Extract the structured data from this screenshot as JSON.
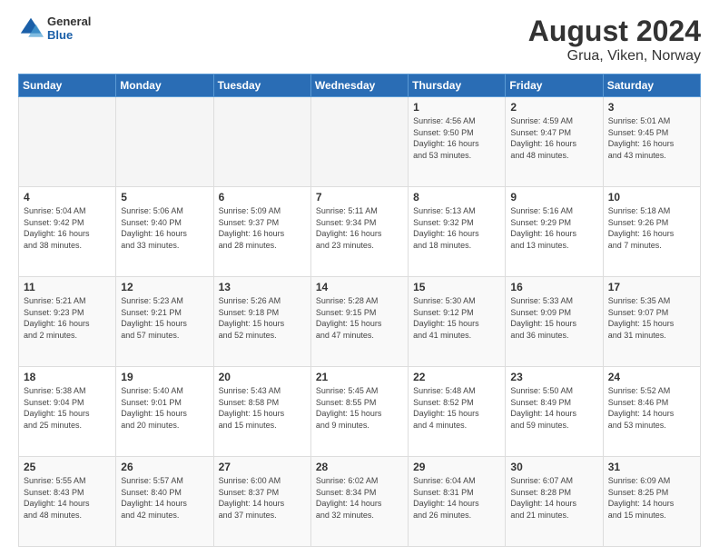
{
  "header": {
    "logo": {
      "general": "General",
      "blue": "Blue"
    },
    "title": "August 2024",
    "subtitle": "Grua, Viken, Norway"
  },
  "weekdays": [
    "Sunday",
    "Monday",
    "Tuesday",
    "Wednesday",
    "Thursday",
    "Friday",
    "Saturday"
  ],
  "weeks": [
    [
      {
        "day": "",
        "info": ""
      },
      {
        "day": "",
        "info": ""
      },
      {
        "day": "",
        "info": ""
      },
      {
        "day": "",
        "info": ""
      },
      {
        "day": "1",
        "info": "Sunrise: 4:56 AM\nSunset: 9:50 PM\nDaylight: 16 hours\nand 53 minutes."
      },
      {
        "day": "2",
        "info": "Sunrise: 4:59 AM\nSunset: 9:47 PM\nDaylight: 16 hours\nand 48 minutes."
      },
      {
        "day": "3",
        "info": "Sunrise: 5:01 AM\nSunset: 9:45 PM\nDaylight: 16 hours\nand 43 minutes."
      }
    ],
    [
      {
        "day": "4",
        "info": "Sunrise: 5:04 AM\nSunset: 9:42 PM\nDaylight: 16 hours\nand 38 minutes."
      },
      {
        "day": "5",
        "info": "Sunrise: 5:06 AM\nSunset: 9:40 PM\nDaylight: 16 hours\nand 33 minutes."
      },
      {
        "day": "6",
        "info": "Sunrise: 5:09 AM\nSunset: 9:37 PM\nDaylight: 16 hours\nand 28 minutes."
      },
      {
        "day": "7",
        "info": "Sunrise: 5:11 AM\nSunset: 9:34 PM\nDaylight: 16 hours\nand 23 minutes."
      },
      {
        "day": "8",
        "info": "Sunrise: 5:13 AM\nSunset: 9:32 PM\nDaylight: 16 hours\nand 18 minutes."
      },
      {
        "day": "9",
        "info": "Sunrise: 5:16 AM\nSunset: 9:29 PM\nDaylight: 16 hours\nand 13 minutes."
      },
      {
        "day": "10",
        "info": "Sunrise: 5:18 AM\nSunset: 9:26 PM\nDaylight: 16 hours\nand 7 minutes."
      }
    ],
    [
      {
        "day": "11",
        "info": "Sunrise: 5:21 AM\nSunset: 9:23 PM\nDaylight: 16 hours\nand 2 minutes."
      },
      {
        "day": "12",
        "info": "Sunrise: 5:23 AM\nSunset: 9:21 PM\nDaylight: 15 hours\nand 57 minutes."
      },
      {
        "day": "13",
        "info": "Sunrise: 5:26 AM\nSunset: 9:18 PM\nDaylight: 15 hours\nand 52 minutes."
      },
      {
        "day": "14",
        "info": "Sunrise: 5:28 AM\nSunset: 9:15 PM\nDaylight: 15 hours\nand 47 minutes."
      },
      {
        "day": "15",
        "info": "Sunrise: 5:30 AM\nSunset: 9:12 PM\nDaylight: 15 hours\nand 41 minutes."
      },
      {
        "day": "16",
        "info": "Sunrise: 5:33 AM\nSunset: 9:09 PM\nDaylight: 15 hours\nand 36 minutes."
      },
      {
        "day": "17",
        "info": "Sunrise: 5:35 AM\nSunset: 9:07 PM\nDaylight: 15 hours\nand 31 minutes."
      }
    ],
    [
      {
        "day": "18",
        "info": "Sunrise: 5:38 AM\nSunset: 9:04 PM\nDaylight: 15 hours\nand 25 minutes."
      },
      {
        "day": "19",
        "info": "Sunrise: 5:40 AM\nSunset: 9:01 PM\nDaylight: 15 hours\nand 20 minutes."
      },
      {
        "day": "20",
        "info": "Sunrise: 5:43 AM\nSunset: 8:58 PM\nDaylight: 15 hours\nand 15 minutes."
      },
      {
        "day": "21",
        "info": "Sunrise: 5:45 AM\nSunset: 8:55 PM\nDaylight: 15 hours\nand 9 minutes."
      },
      {
        "day": "22",
        "info": "Sunrise: 5:48 AM\nSunset: 8:52 PM\nDaylight: 15 hours\nand 4 minutes."
      },
      {
        "day": "23",
        "info": "Sunrise: 5:50 AM\nSunset: 8:49 PM\nDaylight: 14 hours\nand 59 minutes."
      },
      {
        "day": "24",
        "info": "Sunrise: 5:52 AM\nSunset: 8:46 PM\nDaylight: 14 hours\nand 53 minutes."
      }
    ],
    [
      {
        "day": "25",
        "info": "Sunrise: 5:55 AM\nSunset: 8:43 PM\nDaylight: 14 hours\nand 48 minutes."
      },
      {
        "day": "26",
        "info": "Sunrise: 5:57 AM\nSunset: 8:40 PM\nDaylight: 14 hours\nand 42 minutes."
      },
      {
        "day": "27",
        "info": "Sunrise: 6:00 AM\nSunset: 8:37 PM\nDaylight: 14 hours\nand 37 minutes."
      },
      {
        "day": "28",
        "info": "Sunrise: 6:02 AM\nSunset: 8:34 PM\nDaylight: 14 hours\nand 32 minutes."
      },
      {
        "day": "29",
        "info": "Sunrise: 6:04 AM\nSunset: 8:31 PM\nDaylight: 14 hours\nand 26 minutes."
      },
      {
        "day": "30",
        "info": "Sunrise: 6:07 AM\nSunset: 8:28 PM\nDaylight: 14 hours\nand 21 minutes."
      },
      {
        "day": "31",
        "info": "Sunrise: 6:09 AM\nSunset: 8:25 PM\nDaylight: 14 hours\nand 15 minutes."
      }
    ]
  ]
}
